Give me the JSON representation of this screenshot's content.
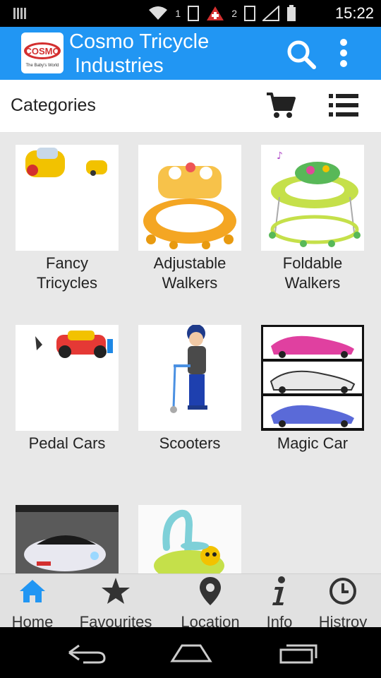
{
  "status_bar": {
    "time": "15:22",
    "sim1_label": "1",
    "sim2_label": "2"
  },
  "app_bar": {
    "title_line1": "Cosmo Tricycle",
    "title_line2": "Industries",
    "logo_text": "COSMO",
    "logo_tagline": "The Baby's World",
    "icons": [
      "search-icon",
      "more-vert-icon"
    ]
  },
  "sub_bar": {
    "title": "Categories",
    "icons": [
      "cart-icon",
      "list-view-icon"
    ]
  },
  "categories": [
    {
      "line1": "Fancy",
      "line2": "Tricycles"
    },
    {
      "line1": "Adjustable",
      "line2": "Walkers"
    },
    {
      "line1": "Foldable",
      "line2": "Walkers"
    },
    {
      "line1": "Pedal Cars",
      "line2": ""
    },
    {
      "line1": "Scooters",
      "line2": ""
    },
    {
      "line1": "Magic Car",
      "line2": ""
    },
    {
      "line1": "",
      "line2": ""
    },
    {
      "line1": "",
      "line2": ""
    }
  ],
  "bottom_nav": [
    {
      "label": "Home",
      "icon": "home-icon",
      "active": true
    },
    {
      "label": "Favourites",
      "icon": "star-icon",
      "active": false
    },
    {
      "label": "Location",
      "icon": "map-pin-icon",
      "active": false
    },
    {
      "label": "Info",
      "icon": "info-icon",
      "active": false
    },
    {
      "label": "Histroy",
      "icon": "clock-icon",
      "active": false
    }
  ],
  "colors": {
    "primary": "#2196f3",
    "active_tab": "#2196f3",
    "inactive_tab": "#333333"
  }
}
